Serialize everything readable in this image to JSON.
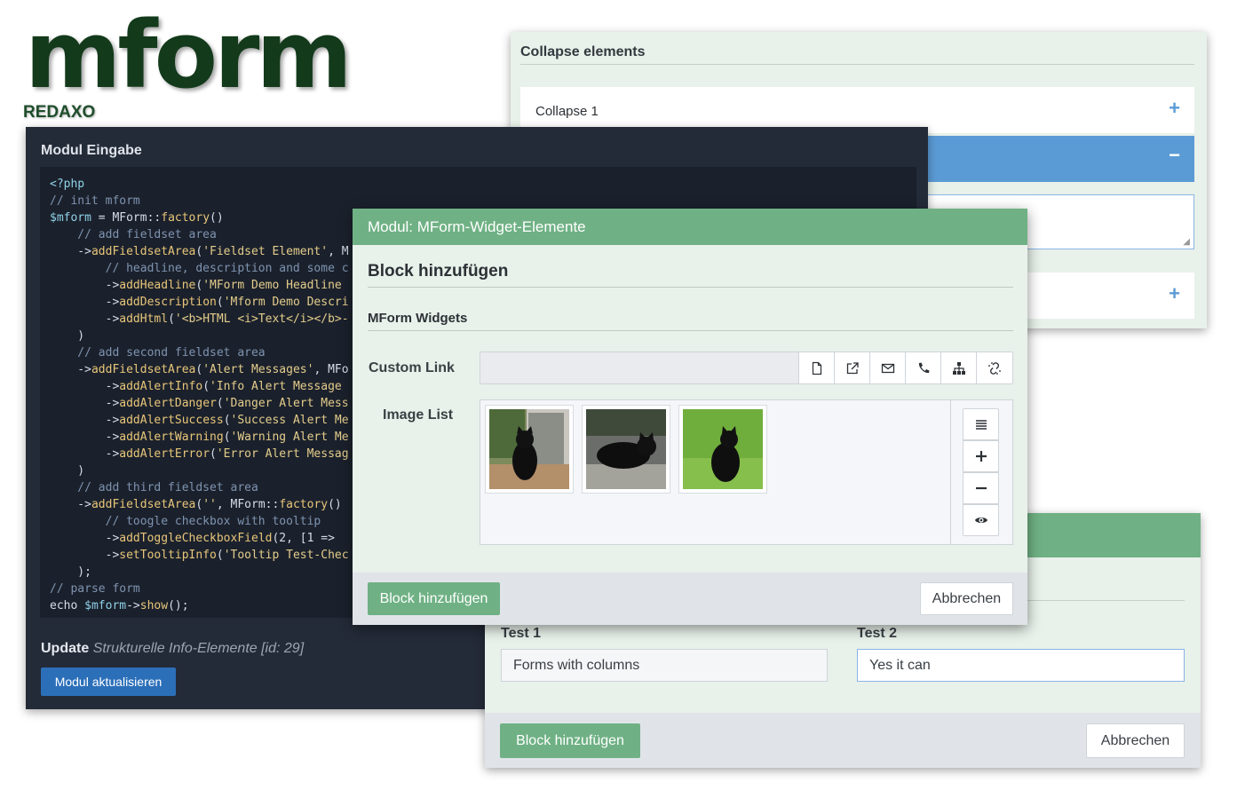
{
  "logo": {
    "wordmark": "mform",
    "sublabel": "REDAXO"
  },
  "collapse_panel": {
    "title": "Collapse elements",
    "rows": [
      {
        "label": "Collapse 1",
        "toggle": "+"
      },
      {
        "label": "",
        "toggle": "−"
      },
      {
        "label": "",
        "toggle": "+"
      }
    ]
  },
  "code_panel": {
    "title": "Modul Eingabe",
    "code_lines": [
      [
        [
          "k-vr",
          "<?php"
        ]
      ],
      [
        [
          "k-cm",
          "// init mform"
        ]
      ],
      [
        [
          "k-vr",
          "$mform"
        ],
        [
          "k-ar",
          " = MForm::"
        ],
        [
          "k-fn",
          "factory"
        ],
        [
          "k-ar",
          "()"
        ]
      ],
      [
        [
          "k-cm",
          "    // add fieldset area"
        ]
      ],
      [
        [
          "k-ar",
          "    ->"
        ],
        [
          "k-fn",
          "addFieldsetArea"
        ],
        [
          "k-ar",
          "("
        ],
        [
          "k-st",
          "'Fieldset Element'"
        ],
        [
          "k-ar",
          ", M"
        ]
      ],
      [
        [
          "k-cm",
          "        // headline, description and some c"
        ]
      ],
      [
        [
          "k-ar",
          "        ->"
        ],
        [
          "k-fn",
          "addHeadline"
        ],
        [
          "k-ar",
          "("
        ],
        [
          "k-st",
          "'MForm Demo Headline"
        ]
      ],
      [
        [
          "k-ar",
          "        ->"
        ],
        [
          "k-fn",
          "addDescription"
        ],
        [
          "k-ar",
          "("
        ],
        [
          "k-st",
          "'Mform Demo Descri"
        ]
      ],
      [
        [
          "k-ar",
          "        ->"
        ],
        [
          "k-fn",
          "addHtml"
        ],
        [
          "k-ar",
          "("
        ],
        [
          "k-st",
          "'<b>HTML <i>Text</i></b>-"
        ]
      ],
      [
        [
          "k-ar",
          "    )"
        ]
      ],
      [
        [
          "k-cm",
          "    // add second fieldset area"
        ]
      ],
      [
        [
          "k-ar",
          "    ->"
        ],
        [
          "k-fn",
          "addFieldsetArea"
        ],
        [
          "k-ar",
          "("
        ],
        [
          "k-st",
          "'Alert Messages'"
        ],
        [
          "k-ar",
          ", MFo"
        ]
      ],
      [
        [
          "k-ar",
          "        ->"
        ],
        [
          "k-fn",
          "addAlertInfo"
        ],
        [
          "k-ar",
          "("
        ],
        [
          "k-st",
          "'Info Alert Message"
        ]
      ],
      [
        [
          "k-ar",
          "        ->"
        ],
        [
          "k-fn",
          "addAlertDanger"
        ],
        [
          "k-ar",
          "("
        ],
        [
          "k-st",
          "'Danger Alert Mess"
        ]
      ],
      [
        [
          "k-ar",
          "        ->"
        ],
        [
          "k-fn",
          "addAlertSuccess"
        ],
        [
          "k-ar",
          "("
        ],
        [
          "k-st",
          "'Success Alert Me"
        ]
      ],
      [
        [
          "k-ar",
          "        ->"
        ],
        [
          "k-fn",
          "addAlertWarning"
        ],
        [
          "k-ar",
          "("
        ],
        [
          "k-st",
          "'Warning Alert Me"
        ]
      ],
      [
        [
          "k-ar",
          "        ->"
        ],
        [
          "k-fn",
          "addAlertError"
        ],
        [
          "k-ar",
          "("
        ],
        [
          "k-st",
          "'Error Alert Messag"
        ]
      ],
      [
        [
          "k-ar",
          "    )"
        ]
      ],
      [
        [
          "k-cm",
          "    // add third fieldset area"
        ]
      ],
      [
        [
          "k-ar",
          "    ->"
        ],
        [
          "k-fn",
          "addFieldsetArea"
        ],
        [
          "k-ar",
          "("
        ],
        [
          "k-st",
          "''"
        ],
        [
          "k-ar",
          ", MForm::"
        ],
        [
          "k-fn",
          "factory"
        ],
        [
          "k-ar",
          "()"
        ]
      ],
      [
        [
          "k-cm",
          "        // toogle checkbox with tooltip"
        ]
      ],
      [
        [
          "k-ar",
          "        ->"
        ],
        [
          "k-fn",
          "addToggleCheckboxField"
        ],
        [
          "k-ar",
          "(2, [1 =>"
        ]
      ],
      [
        [
          "k-ar",
          "        ->"
        ],
        [
          "k-fn",
          "setTooltipInfo"
        ],
        [
          "k-ar",
          "("
        ],
        [
          "k-st",
          "'Tooltip Test-Chec"
        ]
      ],
      [
        [
          "k-ar",
          "    );"
        ]
      ],
      [
        [
          "k-cm",
          "// parse form"
        ]
      ],
      [
        [
          "k-ar",
          "echo "
        ],
        [
          "k-vr",
          "$mform"
        ],
        [
          "k-ar",
          "->"
        ],
        [
          "k-fn",
          "show"
        ],
        [
          "k-ar",
          "();"
        ]
      ]
    ],
    "update_label": "Update",
    "update_meta": "Strukturelle Info-Elemente [id: 29]",
    "update_button": "Modul aktualisieren"
  },
  "columns_panel": {
    "col1_label": "Test 1",
    "col1_value": "Forms with columns",
    "col2_label": "Test 2",
    "col2_value": "Yes it can",
    "submit": "Block hinzufügen",
    "cancel": "Abbrechen"
  },
  "widget_modal": {
    "title": "Modul: MForm-Widget-Elemente",
    "block_heading": "Block hinzufügen",
    "widgets_heading": "MForm Widgets",
    "link_label": "Custom Link",
    "link_value": "",
    "link_buttons": [
      "file-icon",
      "external-link-icon",
      "mail-icon",
      "phone-icon",
      "sitemap-icon",
      "unlink-icon"
    ],
    "imglist_label": "Image List",
    "images": [
      "cat-by-window",
      "cat-lying-on-pavement",
      "cat-sitting-on-grass"
    ],
    "sidebar_buttons": [
      "list-icon",
      "plus-icon",
      "minus-icon",
      "eye-icon"
    ],
    "submit": "Block hinzufügen",
    "cancel": "Abbrechen"
  },
  "colors": {
    "accent_green": "#6fb184",
    "accent_blue": "#5b9bd5",
    "editor_bg": "#242b38",
    "logo_green": "#133a1b"
  }
}
